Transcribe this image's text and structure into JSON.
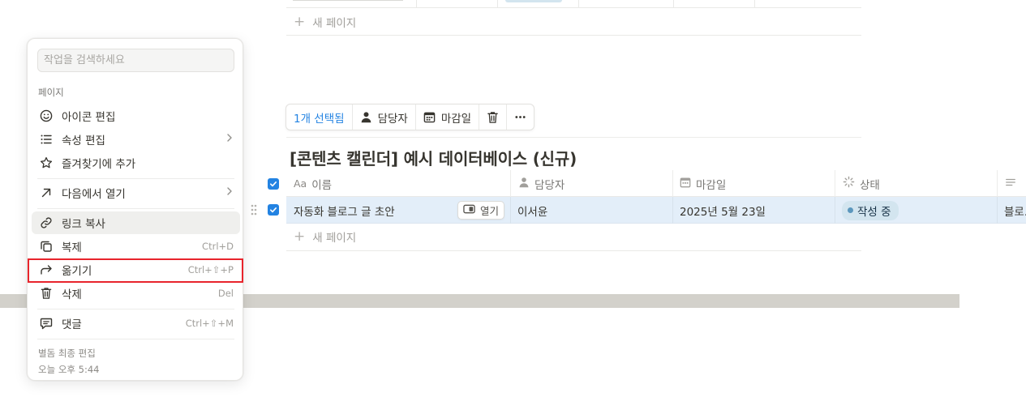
{
  "table_above": {
    "new_page": "새 페이지"
  },
  "toolbar": {
    "selected": "1개 선택됨",
    "assignee": "담당자",
    "due_date": "마감일",
    "delete_icon": "trash-icon",
    "more_icon": "ellipsis-icon"
  },
  "database": {
    "title": "[콘텐츠 캘린더] 예시 데이터베이스 (신규)",
    "columns": [
      {
        "prefix": "Aa",
        "label": "이름"
      },
      {
        "icon": "person-icon",
        "label": "담당자"
      },
      {
        "icon": "calendar-icon",
        "label": "마감일"
      },
      {
        "icon": "status-icon",
        "label": "상태"
      },
      {
        "icon": "text-lines-icon",
        "label": ""
      }
    ],
    "rows": [
      {
        "name": "자동화 블로그 글 초안",
        "open_label": "열기",
        "assignee": "이서윤",
        "due": "2025년 5월 23일",
        "status": "작성 중",
        "extra": "블로."
      }
    ],
    "new_page": "새 페이지"
  },
  "menu": {
    "search_placeholder": "작업을 검색하세요",
    "section": "페이지",
    "items": [
      {
        "icon": "smiley-icon",
        "label": "아이콘 편집"
      },
      {
        "icon": "list-icon",
        "label": "속성 편집",
        "chevron": true
      },
      {
        "icon": "star-icon",
        "label": "즐겨찾기에 추가"
      },
      {
        "icon": "arrow-up-right-icon",
        "label": "다음에서 열기",
        "chevron": true
      },
      {
        "icon": "link-icon",
        "label": "링크 복사"
      },
      {
        "icon": "duplicate-icon",
        "label": "복제",
        "shortcut": "Ctrl+D"
      },
      {
        "icon": "move-arrow-icon",
        "label": "옮기기",
        "shortcut": "Ctrl+⇧+P"
      },
      {
        "icon": "trash-icon",
        "label": "삭제",
        "shortcut": "Del"
      },
      {
        "icon": "comment-icon",
        "label": "댓글",
        "shortcut": "Ctrl+⇧+M"
      }
    ],
    "footer_line1": "별돔 최종 편집",
    "footer_line2": "오늘 오후 5:44"
  },
  "colors": {
    "accent": "#2383e2",
    "row_selected": "#e3eef9",
    "status_pill": "#d3e5ef",
    "highlight": "#e8242c",
    "band": "#d3d1cb"
  }
}
